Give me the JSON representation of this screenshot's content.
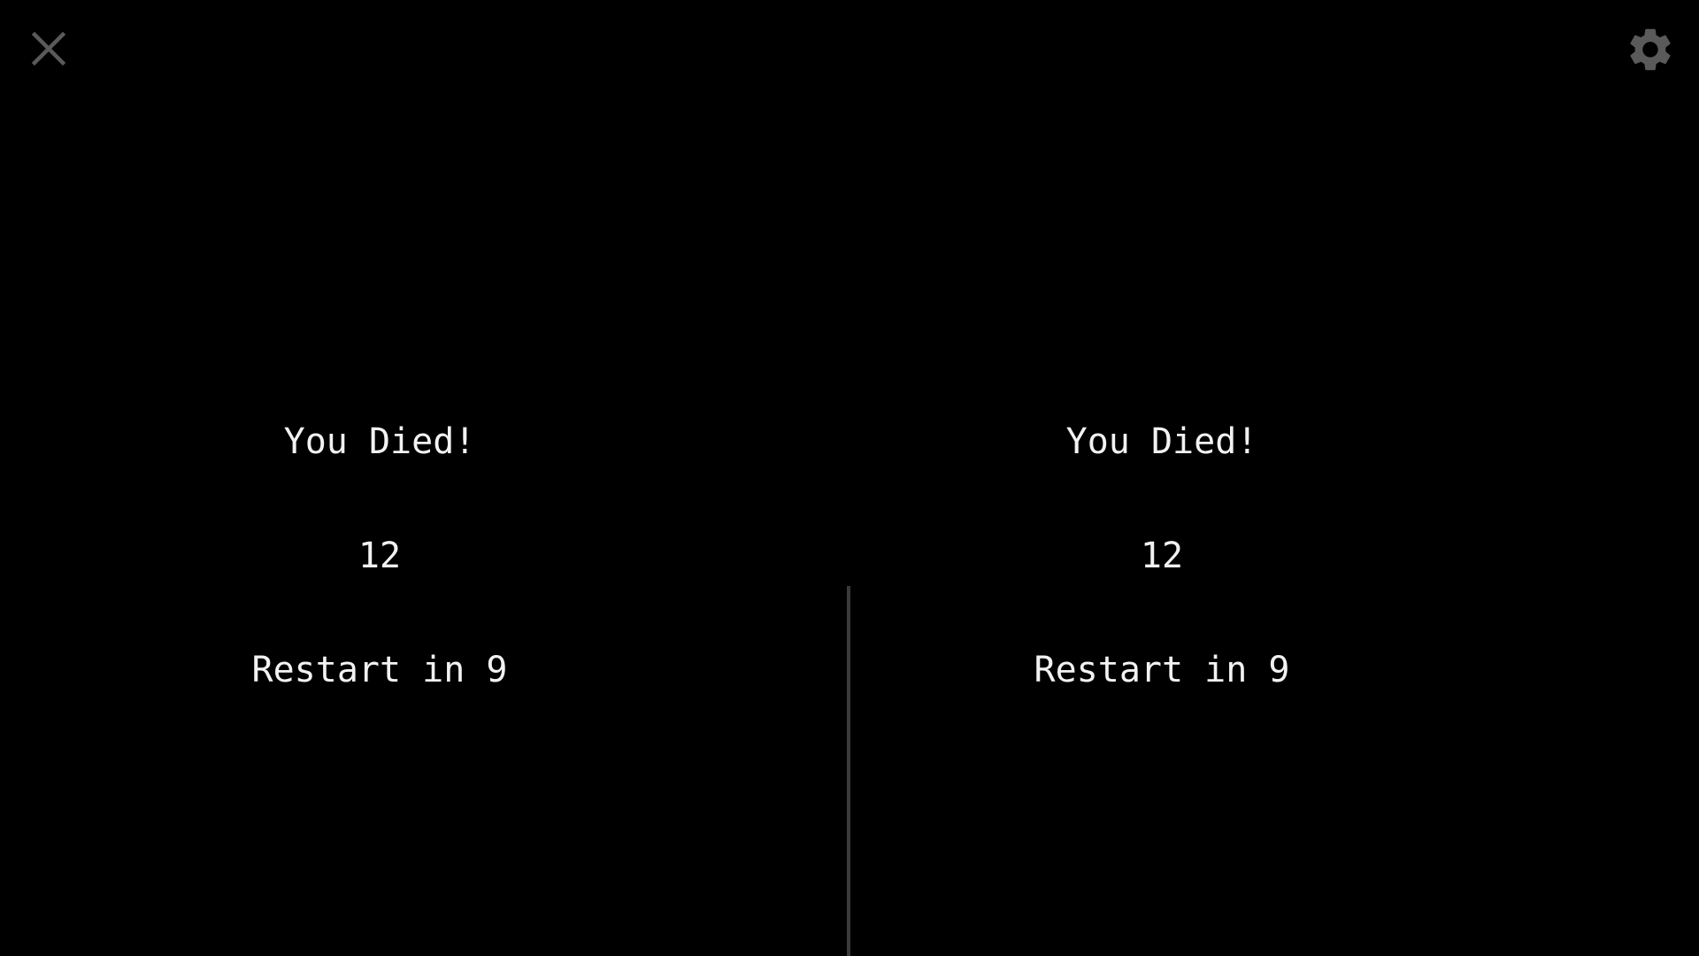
{
  "viewer": {
    "close_icon": "close-icon",
    "settings_icon": "gear-icon",
    "icon_color": "#5a5a5a",
    "divider_color": "#3a3a3a",
    "background": "#000000"
  },
  "left_eye": {
    "title": "You Died!",
    "score": "12",
    "restart": "Restart in 9"
  },
  "right_eye": {
    "title": "You Died!",
    "score": "12",
    "restart": "Restart in 9"
  }
}
